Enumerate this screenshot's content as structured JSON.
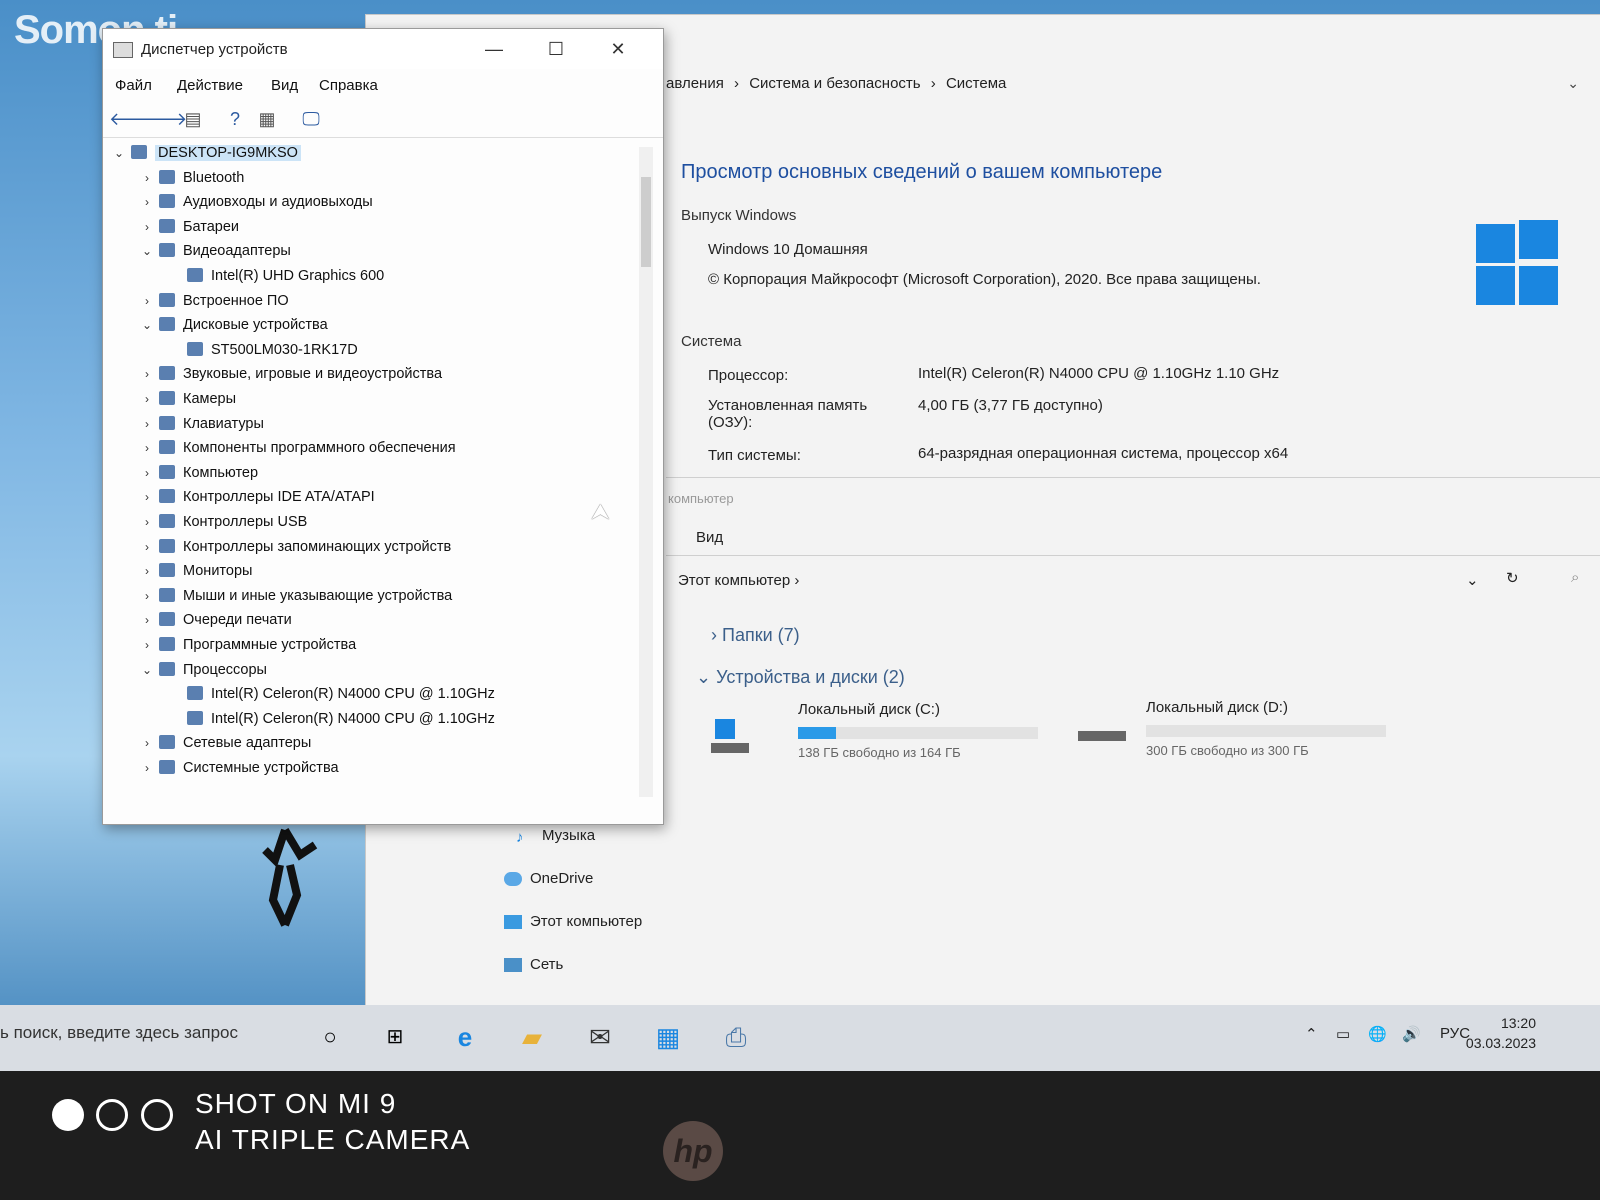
{
  "watermark": "Somon.tj",
  "system_window": {
    "breadcrumb": [
      "авления",
      "›",
      "Система и безопасность",
      "›",
      "Система"
    ],
    "title": "Просмотр основных сведений о вашем компьютере",
    "edition_header": "Выпуск Windows",
    "edition": "Windows 10 Домашняя",
    "copyright": "© Корпорация Майкрософт (Microsoft Corporation), 2020. Все права защищены.",
    "system_header": "Система",
    "processor_label": "Процессор:",
    "processor_value": "Intel(R) Celeron(R) N4000 CPU @ 1.10GHz   1.10 GHz",
    "memory_label": "Установленная память (ОЗУ):",
    "memory_value": "4,00 ГБ (3,77 ГБ доступно)",
    "type_label": "Тип системы:",
    "type_value": "64-разрядная операционная система, процессор x64"
  },
  "explorer": {
    "section_faded": "компьютер",
    "view_label": "Вид",
    "address": "Этот компьютер  ›",
    "folders_group": "Папки (7)",
    "devices_group": "Устройства и диски (2)",
    "disk_c": {
      "name": "Локальный диск (C:)",
      "free": "138 ГБ свободно из 164 ГБ",
      "used_fraction": 0.16
    },
    "disk_d": {
      "name": "Локальный диск (D:)",
      "free": "300 ГБ свободно из 300 ГБ"
    },
    "nav": [
      "Музыка",
      "OneDrive",
      "Этот компьютер",
      "Сеть"
    ]
  },
  "device_manager": {
    "title": "Диспетчер устройств",
    "menu": [
      "Файл",
      "Действие",
      "Вид",
      "Справка"
    ],
    "tree": [
      {
        "label": "DESKTOP-IG9MKSO",
        "exp": "⌄",
        "level": 0
      },
      {
        "label": "Bluetooth",
        "exp": "›",
        "level": 1
      },
      {
        "label": "Аудиовходы и аудиовыходы",
        "exp": "›",
        "level": 1
      },
      {
        "label": "Батареи",
        "exp": "›",
        "level": 1
      },
      {
        "label": "Видеоадаптеры",
        "exp": "⌄",
        "level": 1
      },
      {
        "label": "Intel(R) UHD Graphics 600",
        "exp": "",
        "level": 2
      },
      {
        "label": "Встроенное ПО",
        "exp": "›",
        "level": 1
      },
      {
        "label": "Дисковые устройства",
        "exp": "⌄",
        "level": 1
      },
      {
        "label": "ST500LM030-1RK17D",
        "exp": "",
        "level": 2
      },
      {
        "label": "Звуковые, игровые и видеоустройства",
        "exp": "›",
        "level": 1
      },
      {
        "label": "Камеры",
        "exp": "›",
        "level": 1
      },
      {
        "label": "Клавиатуры",
        "exp": "›",
        "level": 1
      },
      {
        "label": "Компоненты программного обеспечения",
        "exp": "›",
        "level": 1
      },
      {
        "label": "Компьютер",
        "exp": "›",
        "level": 1
      },
      {
        "label": "Контроллеры IDE ATA/ATAPI",
        "exp": "›",
        "level": 1
      },
      {
        "label": "Контроллеры USB",
        "exp": "›",
        "level": 1
      },
      {
        "label": "Контроллеры запоминающих устройств",
        "exp": "›",
        "level": 1
      },
      {
        "label": "Мониторы",
        "exp": "›",
        "level": 1
      },
      {
        "label": "Мыши и иные указывающие устройства",
        "exp": "›",
        "level": 1
      },
      {
        "label": "Очереди печати",
        "exp": "›",
        "level": 1
      },
      {
        "label": "Программные устройства",
        "exp": "›",
        "level": 1
      },
      {
        "label": "Процессоры",
        "exp": "⌄",
        "level": 1
      },
      {
        "label": "Intel(R) Celeron(R) N4000 CPU @ 1.10GHz",
        "exp": "",
        "level": 2
      },
      {
        "label": "Intel(R) Celeron(R) N4000 CPU @ 1.10GHz",
        "exp": "",
        "level": 2
      },
      {
        "label": "Сетевые адаптеры",
        "exp": "›",
        "level": 1
      },
      {
        "label": "Системные устройства",
        "exp": "›",
        "level": 1
      }
    ]
  },
  "taskbar": {
    "search_placeholder": "ь поиск, введите здесь запрос",
    "lang": "РУС",
    "time": "13:20",
    "date": "03.03.2023"
  },
  "camera": {
    "line1": "SHOT ON MI 9",
    "line2": "AI TRIPLE CAMERA",
    "brand": "hp"
  },
  "colors": {
    "accent": "#1a86e0",
    "title_blue": "#1e4fa0",
    "selection": "#cce4f7"
  }
}
